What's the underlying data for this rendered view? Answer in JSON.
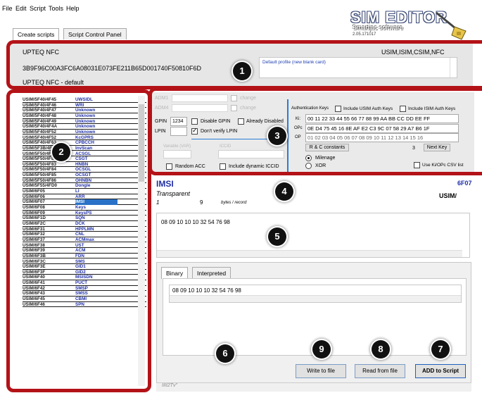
{
  "menu": [
    "File",
    "Edit",
    "Script",
    "Tools",
    "Help"
  ],
  "logo": {
    "title": "SIM EDITOR",
    "subtitle": "Smartjac software",
    "version": "2.05.171017"
  },
  "tabs": [
    "Create scripts",
    "Script Control Panel"
  ],
  "header": {
    "card_name": "UPTEQ NFC",
    "apps": "USIM,ISIM,CSIM,NFC",
    "iccid": "3B9F96C00A3FC6A08031E073FE211B65D001740F50810F6D",
    "profile_name": "UPTEQ NFC - default",
    "profile_desc": "Default profile (new blank card)"
  },
  "file_list": [
    [
      "USIM/5F40/4F45",
      "UWSIDL"
    ],
    [
      "USIM/5F40/4F46",
      "WRI"
    ],
    [
      "USIM/5F40/4F47",
      "Unknown"
    ],
    [
      "USIM/5F40/4F48",
      "Unknown"
    ],
    [
      "USIM/5F40/4F49",
      "Unknown"
    ],
    [
      "USIM/5F40/4F4A",
      "Unknown"
    ],
    [
      "USIM/5F40/4F52",
      "Unknown"
    ],
    [
      "USIM/5F40/4F52",
      "KcGPRS"
    ],
    [
      "USIM/5F40/4F63",
      "CPBCCH"
    ],
    [
      "USIM/5F3B/4F64",
      "InvScan"
    ],
    [
      "USIM/5F50/4F81",
      "ACSGL"
    ],
    [
      "USIM/5F50/4F82",
      "CSGT"
    ],
    [
      "USIM/5F50/4F83",
      "HNBN"
    ],
    [
      "USIM/5F50/4F84",
      "OCSGL"
    ],
    [
      "USIM/5F50/4F85",
      "OCSGT"
    ],
    [
      "USIM/5F50/4F86",
      "OHNBN"
    ],
    [
      "USIM/5F55/4FD0",
      "Dongle"
    ],
    [
      "USIM/6F05",
      "LI"
    ],
    [
      "USIM/6F06",
      "ARR"
    ],
    [
      "USIM/6F07",
      "IMSI"
    ],
    [
      "USIM/6F08",
      "Keys"
    ],
    [
      "USIM/6F09",
      "KeysPS"
    ],
    [
      "USIM/6F1D",
      "SQN"
    ],
    [
      "USIM/6F2C",
      "DCK"
    ],
    [
      "USIM/6F31",
      "HPPLMN"
    ],
    [
      "USIM/6F32",
      "CNL"
    ],
    [
      "USIM/6F37",
      "ACMmax"
    ],
    [
      "USIM/6F38",
      "UST"
    ],
    [
      "USIM/6F39",
      "ACM"
    ],
    [
      "USIM/6F3B",
      "FDN"
    ],
    [
      "USIM/6F3C",
      "SMS"
    ],
    [
      "USIM/6F3E",
      "GID1"
    ],
    [
      "USIM/6F3F",
      "GID2"
    ],
    [
      "USIM/6F40",
      "MSISDN"
    ],
    [
      "USIM/6F41",
      "PUCT"
    ],
    [
      "USIM/6F42",
      "SMSP"
    ],
    [
      "USIM/6F43",
      "SMSS"
    ],
    [
      "USIM/6F45",
      "CBMI"
    ],
    [
      "USIM/6F46",
      "SPN"
    ]
  ],
  "selected_file": "IMSI",
  "params": {
    "adm1_label": "ADM1",
    "adm4_label": "ADM4",
    "change_label": "change",
    "gpin_label": "GPIN",
    "gpin_value": "1234",
    "lpin_label": "LPIN",
    "disable_gpin": "Disable GPIN",
    "already_disabled": "Already Disabled",
    "dont_verify_lpin": "Don't verify LPIN",
    "variable_label": "Variable (VAR)",
    "iccid_label": "ICCID",
    "random_acc": "Random ACC",
    "include_dynamic_iccid": "Include dynamic ICCID",
    "auth_keys_label": "Authentication Keys",
    "include_usim_auth": "Include USIM Auth Keys",
    "include_isim_auth": "Include ISIM Auth Keys",
    "ki_label": "Ki:",
    "ki_value": "00 11 22 33 44 55 66 77 88 99 AA BB CC DD EE FF",
    "opc_label": "OPc",
    "opc_value": "0E D4 75 45 16 8E AF E2 C3 9C 07 58 29 A7 B6 1F",
    "op_label": "OP",
    "op_value": "01 02 03 04 05 06 07 08 09 10 11 12 13 14 15 16",
    "rc_constants": "R & C constants",
    "key_count": "3",
    "next_key": "Next Key",
    "milenage": "Milenage",
    "xor": "XOR",
    "use_csv": "Use Ki/OPc CSV list"
  },
  "file_detail": {
    "name": "IMSI",
    "id": "6F07",
    "type": "Transparent",
    "records": "1",
    "record_size": "9",
    "record_unit": "bytes / record",
    "app": "USIM/",
    "value": "08 09 10 10 10 32 54 76 98"
  },
  "lower_tabs": [
    "Binary",
    "Interpreted"
  ],
  "binary_value": "08 09 10 10 10 32 54 76 98",
  "buttons": {
    "write": "Write to file",
    "read": "Read from file",
    "add": "ADD to Script"
  },
  "status_text": "IIII2Tv\"",
  "callouts": [
    "1",
    "2",
    "3",
    "4",
    "5",
    "6",
    "7",
    "8",
    "9"
  ],
  "accent_color": "#b31217"
}
